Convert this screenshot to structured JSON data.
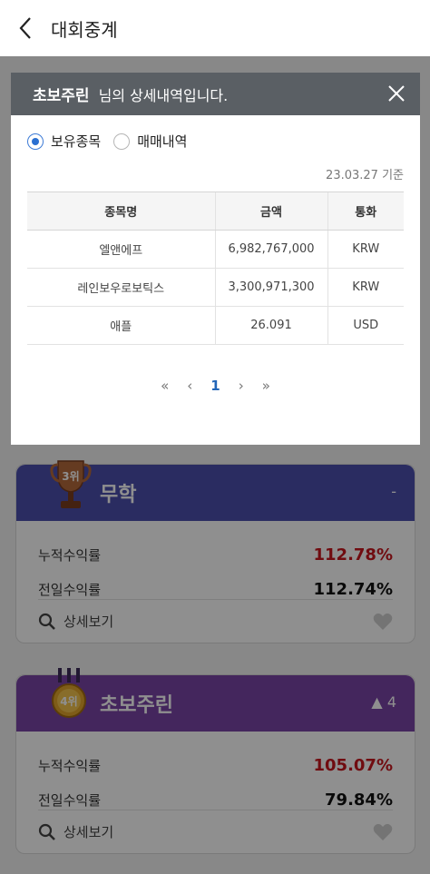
{
  "header": {
    "title": "대회중계",
    "back_icon": "chevron-left-icon"
  },
  "modal": {
    "user": "초보주린",
    "title_suffix": "님의 상세내역입니다.",
    "tabs": [
      {
        "label": "보유종목",
        "selected": true
      },
      {
        "label": "매매내역",
        "selected": false
      }
    ],
    "as_of": "23.03.27 기준",
    "columns": [
      "종목명",
      "금액",
      "통화"
    ],
    "rows": [
      [
        "엘앤에프",
        "6,982,767,000",
        "KRW"
      ],
      [
        "레인보우로보틱스",
        "3,300,971,300",
        "KRW"
      ],
      [
        "애플",
        "26.091",
        "USD"
      ]
    ],
    "pager": {
      "first": "«",
      "prev": "‹",
      "current": "1",
      "next": "›",
      "last": "»"
    }
  },
  "cards": [
    {
      "rank": "3위",
      "name": "무학",
      "change": "-",
      "header_color": "#4b4fae",
      "cum_label": "누적수익률",
      "cum_value": "112.78%",
      "day_label": "전일수익률",
      "day_value": "112.74%",
      "detail_label": "상세보기"
    },
    {
      "rank": "4위",
      "name": "초보주린",
      "change": "▲ 4",
      "header_color": "#7a45a6",
      "cum_label": "누적수익률",
      "cum_value": "105.07%",
      "day_label": "전일수익률",
      "day_value": "79.84%",
      "detail_label": "상세보기"
    }
  ]
}
